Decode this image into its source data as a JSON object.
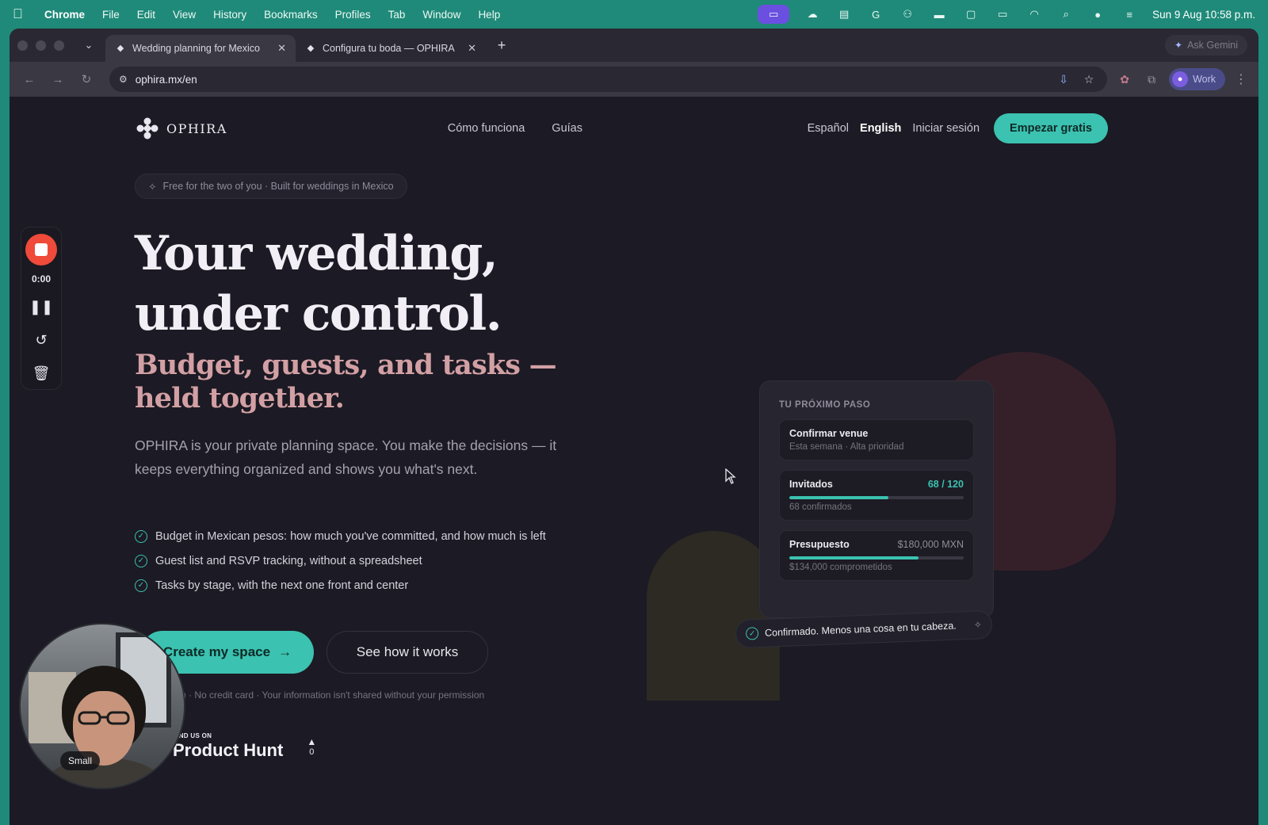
{
  "menubar": {
    "app": "Chrome",
    "items": [
      "File",
      "Edit",
      "View",
      "History",
      "Bookmarks",
      "Profiles",
      "Tab",
      "Window",
      "Help"
    ],
    "clock": "Sun 9 Aug  10:58 p.m."
  },
  "browser": {
    "tabs": [
      {
        "title": "Wedding planning for Mexico",
        "active": true
      },
      {
        "title": "Configura tu boda — OPHIRA",
        "active": false
      }
    ],
    "gemini_label": "Ask Gemini",
    "url": "ophira.mx/en",
    "profile_label": "Work"
  },
  "site": {
    "logo_text": "OPHIRA",
    "nav": [
      "Cómo funciona",
      "Guías"
    ],
    "lang_es": "Español",
    "lang_en": "English",
    "login": "Iniciar sesión",
    "cta": "Empezar gratis"
  },
  "hero": {
    "badge": "Free for the two of you · Built for weddings in Mexico",
    "title_line1": "Your wedding,",
    "title_line2": "under control.",
    "subtitle": "Budget, guests, and tasks — held together.",
    "body": "OPHIRA is your private planning space. You make the decisions — it keeps everything organized and shows you what's next.",
    "features": [
      "Budget in Mexican pesos: how much you've committed, and how much is left",
      "Guest list and RSVP tracking, without a spreadsheet",
      "Tasks by stage, with the next one front and center"
    ],
    "primary_cta": "Create my space",
    "secondary_cta": "See how it works",
    "fine_print": "e two of you · No credit card · Your information isn't shared without your permission"
  },
  "product_hunt": {
    "find_label": "FIND US ON",
    "name": "Product Hunt",
    "votes": "0"
  },
  "dashboard": {
    "eyebrow": "TU PRÓXIMO PASO",
    "next": {
      "title": "Confirmar venue",
      "sub": "Esta semana · Alta prioridad"
    },
    "guests": {
      "title": "Invitados",
      "value": "68 / 120",
      "sub": "68 confirmados",
      "progress": 0.57
    },
    "budget": {
      "title": "Presupuesto",
      "value": "$180,000 MXN",
      "sub": "$134,000 comprometidos",
      "progress": 0.74
    },
    "toast": "Confirmado. Menos una cosa en tu cabeza."
  },
  "recorder": {
    "time": "0:00"
  },
  "webcam": {
    "size_label": "Small"
  },
  "colors": {
    "accent": "#3bc2b0",
    "subtitle": "#d2a0a4",
    "record": "#ef4a3a",
    "desktop": "#1f8a79"
  }
}
